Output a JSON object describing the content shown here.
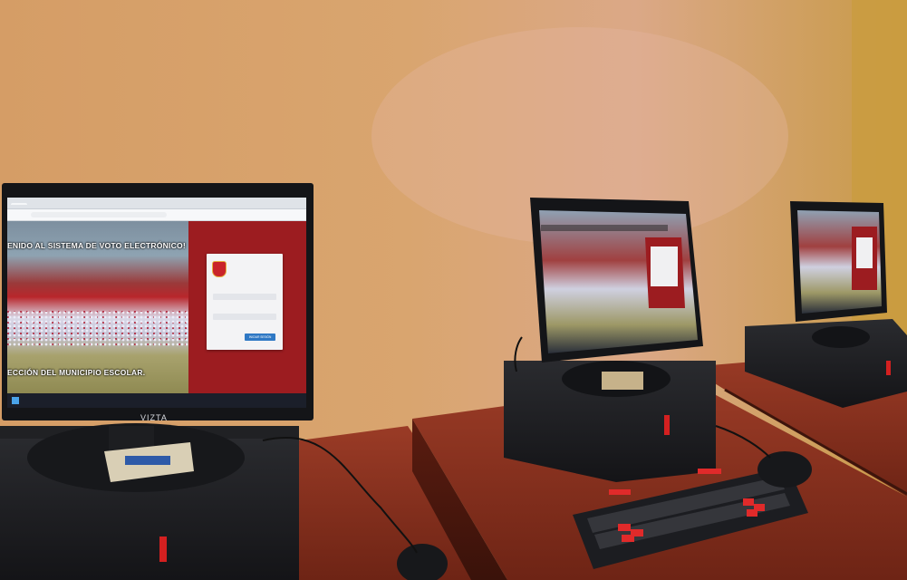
{
  "scene": {
    "description_free": true
  },
  "left_monitor": {
    "brand": "VIZTA",
    "browser": {
      "tab_label": "",
      "address": ""
    },
    "page": {
      "banner_top": "ENIDO AL SISTEMA DE VOTO ELECTRÓNICO!",
      "banner_bottom": "ECCIÓN DEL MUNICIPIO ESCOLAR.",
      "login": {
        "button_label": "INICIAR SESIÓN"
      }
    }
  },
  "colors": {
    "wall": "#d9a26a",
    "desk": "#8e2f1f",
    "login_panel": "#9c1c20",
    "button": "#2f78c4",
    "keyboard_accent": "#e02a2a"
  }
}
